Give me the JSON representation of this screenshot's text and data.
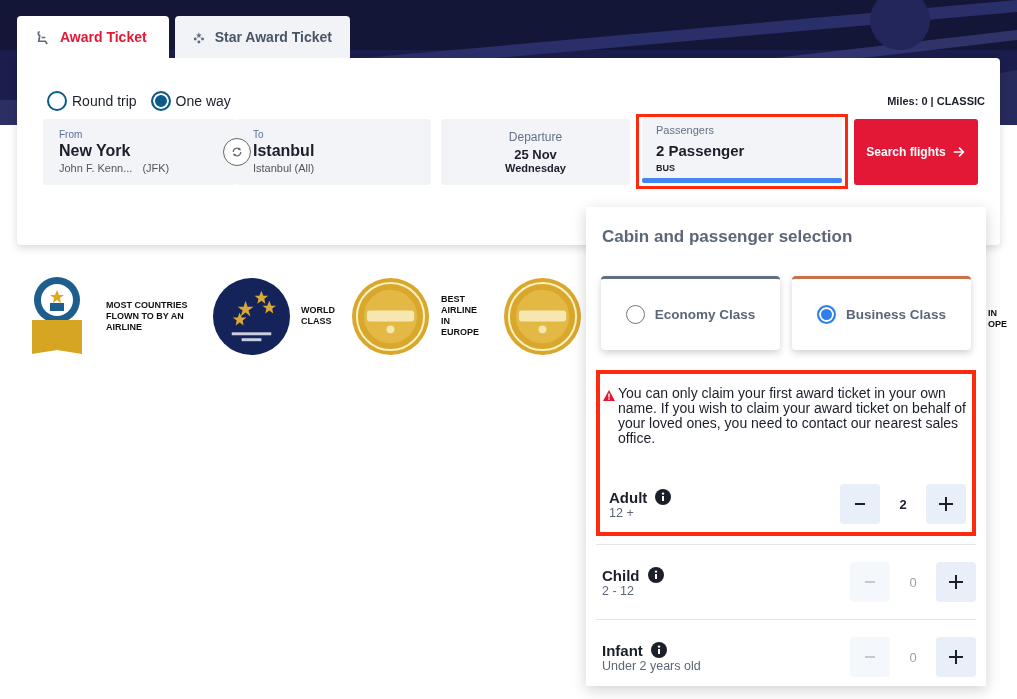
{
  "tabs": [
    {
      "label": "Award Ticket",
      "selected": true,
      "kind": "award"
    },
    {
      "label": "Star Award Ticket",
      "selected": false,
      "kind": "star"
    }
  ],
  "trip_type": [
    {
      "label": "Round trip",
      "selected": false
    },
    {
      "label": "One way",
      "selected": true
    }
  ],
  "miles": "Miles: 0 | CLASSIC",
  "from": {
    "label": "From",
    "city": "New York",
    "airport": "John F. Kenn...",
    "code": "(JFK)"
  },
  "to": {
    "label": "To",
    "city": "Istanbul",
    "airport": "Istanbul (All)"
  },
  "departure": {
    "label": "Departure",
    "date": "25 Nov",
    "weekday": "Wednesday"
  },
  "passengers": {
    "label": "Passengers",
    "value": "2 Passenger",
    "cabin": "BUS",
    "expanded": true,
    "highlighted": true
  },
  "search_button": "Search flights",
  "awards": [
    {
      "kind": "record",
      "caption": [
        "MOST COUNTRIES",
        "FLOWN TO BY AN",
        "AIRLINE"
      ]
    },
    {
      "kind": "apex",
      "caption": [
        "WORLD",
        "CLASS"
      ]
    },
    {
      "kind": "skytrax",
      "caption": [
        "BEST",
        "AIRLINE",
        "IN",
        "EUROPE"
      ]
    },
    {
      "kind": "skytrax"
    },
    {
      "kind": "none",
      "caption": [
        "IN",
        "OPE"
      ]
    }
  ],
  "popup": {
    "title": "Cabin and passenger selection",
    "cabins": [
      {
        "label": "Economy Class",
        "selected": false,
        "color": "#5f6e80"
      },
      {
        "label": "Business Class",
        "selected": true,
        "color": "#c8714a"
      }
    ],
    "highlighted": true,
    "warning": "You can only claim your first award ticket in your own name. If you wish to claim your award ticket on behalf of your loved ones, you need to contact our nearest sales office.",
    "travellers": [
      {
        "type": "Adult",
        "range": "12 +",
        "count": "2",
        "decrease_disabled": false
      },
      {
        "type": "Child",
        "range": "2 - 12",
        "count": "0",
        "decrease_disabled": true
      },
      {
        "type": "Infant",
        "range": "Under 2 years old",
        "count": "0",
        "decrease_disabled": true
      }
    ]
  }
}
